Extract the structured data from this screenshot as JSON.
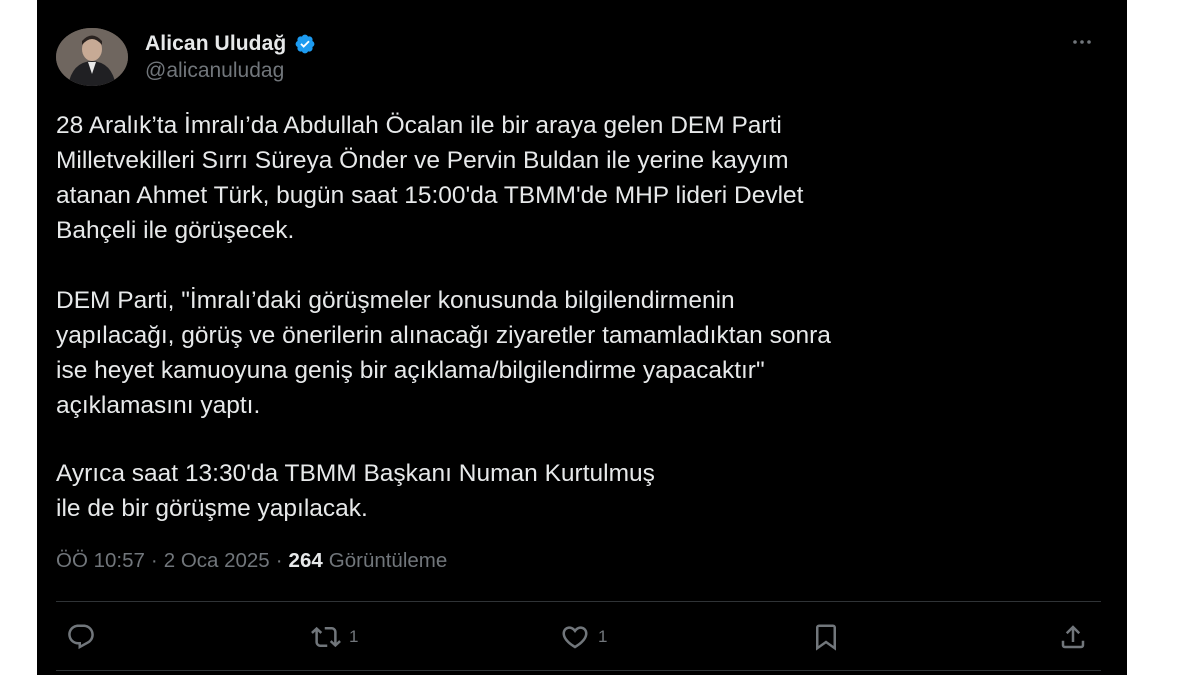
{
  "author": {
    "display_name": "Alican Uludağ",
    "handle": "@alicanuludag",
    "verified": true,
    "verified_color": "#1d9bf0"
  },
  "tweet": {
    "paragraphs": [
      "28 Aralık’ta İmralı’da Abdullah Öcalan ile bir araya gelen DEM Parti\nMilletvekilleri Sırrı Süreya Önder ve Pervin Buldan ile yerine kayyım\natanan Ahmet Türk, bugün saat 15:00'da TBMM'de MHP lideri Devlet\nBahçeli ile görüşecek.",
      "DEM Parti, \"İmralı’daki görüşmeler konusunda bilgilendirmenin\nyapılacağı, görüş ve önerilerin alınacağı ziyaretler tamamladıktan sonra\nise heyet kamuoyuna geniş bir açıklama/bilgilendirme yapacaktır\"\naçıklamasını yaptı.",
      "Ayrıca saat 13:30'da TBMM Başkanı Numan Kurtulmuş\nile de bir görüşme yapılacak."
    ]
  },
  "meta": {
    "time": "ÖÖ 10:57",
    "separator": "·",
    "date": "2 Oca 2025",
    "views_count": "264",
    "views_label": "Görüntüleme"
  },
  "actions": {
    "reply_count": "",
    "retweet_count": "1",
    "like_count": "1"
  },
  "icons": {
    "more": "more-icon",
    "reply": "reply-icon",
    "retweet": "retweet-icon",
    "like": "heart-icon",
    "bookmark": "bookmark-icon",
    "share": "share-icon"
  },
  "colors": {
    "background": "#000000",
    "text": "#e7e9ea",
    "secondary": "#71767b",
    "divider": "#2f3336"
  }
}
